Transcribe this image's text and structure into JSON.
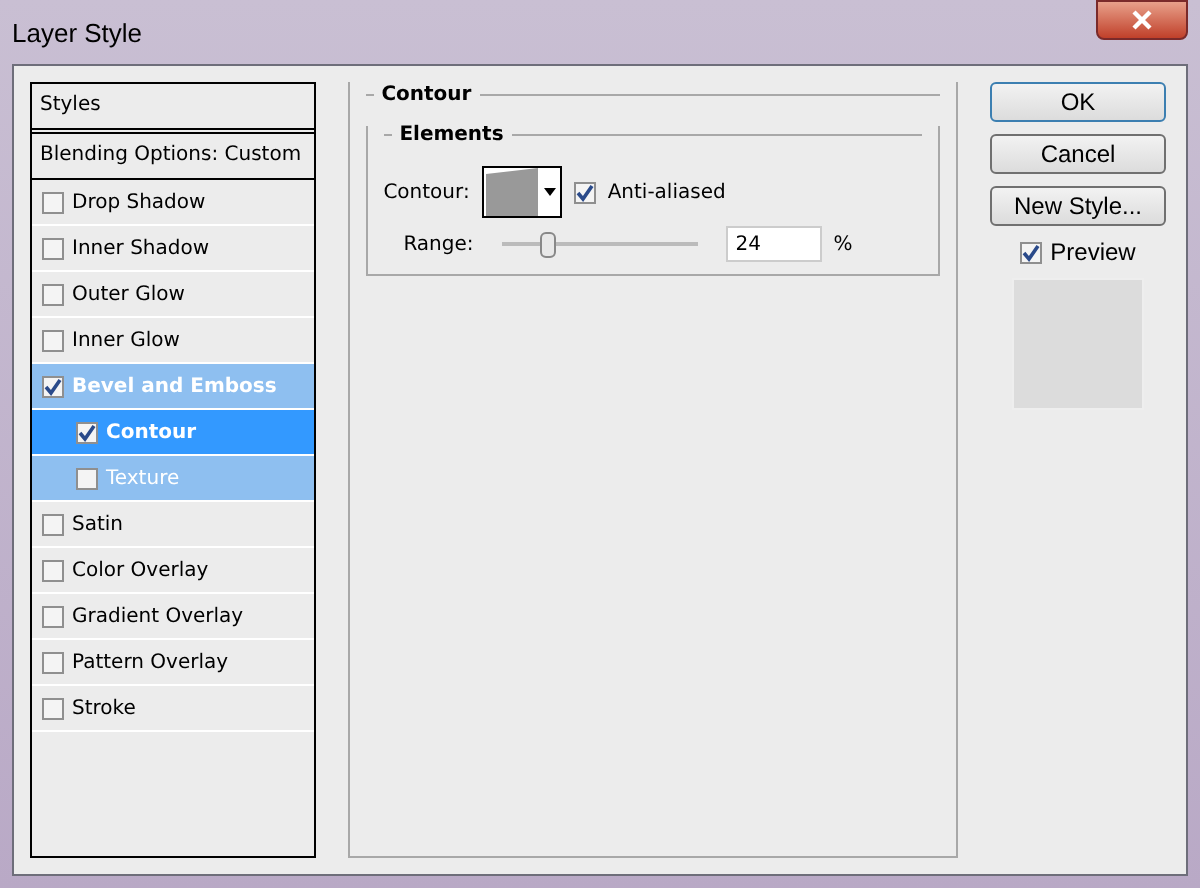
{
  "window": {
    "title": "Layer Style"
  },
  "styles": {
    "header": "Styles",
    "blending": "Blending Options: Custom",
    "items": [
      {
        "label": "Drop Shadow",
        "checked": false,
        "selected": false
      },
      {
        "label": "Inner Shadow",
        "checked": false,
        "selected": false
      },
      {
        "label": "Outer Glow",
        "checked": false,
        "selected": false
      },
      {
        "label": "Inner Glow",
        "checked": false,
        "selected": false
      },
      {
        "label": "Bevel and Emboss",
        "checked": true,
        "selected": false,
        "children": [
          {
            "label": "Contour",
            "checked": true,
            "selected": true
          },
          {
            "label": "Texture",
            "checked": false,
            "selected": false
          }
        ]
      },
      {
        "label": "Satin",
        "checked": false,
        "selected": false
      },
      {
        "label": "Color Overlay",
        "checked": false,
        "selected": false
      },
      {
        "label": "Gradient Overlay",
        "checked": false,
        "selected": false
      },
      {
        "label": "Pattern Overlay",
        "checked": false,
        "selected": false
      },
      {
        "label": "Stroke",
        "checked": false,
        "selected": false
      }
    ]
  },
  "panel": {
    "title": "Contour",
    "group": "Elements",
    "contour_label": "Contour:",
    "anti_aliased": {
      "label": "Anti-aliased",
      "checked": true
    },
    "range": {
      "label": "Range:",
      "level": 0.24,
      "value": "24",
      "unit": "%"
    }
  },
  "buttons": [
    "OK",
    "Cancel",
    "New Style..."
  ],
  "preview": {
    "label": "Preview",
    "checked": true
  }
}
